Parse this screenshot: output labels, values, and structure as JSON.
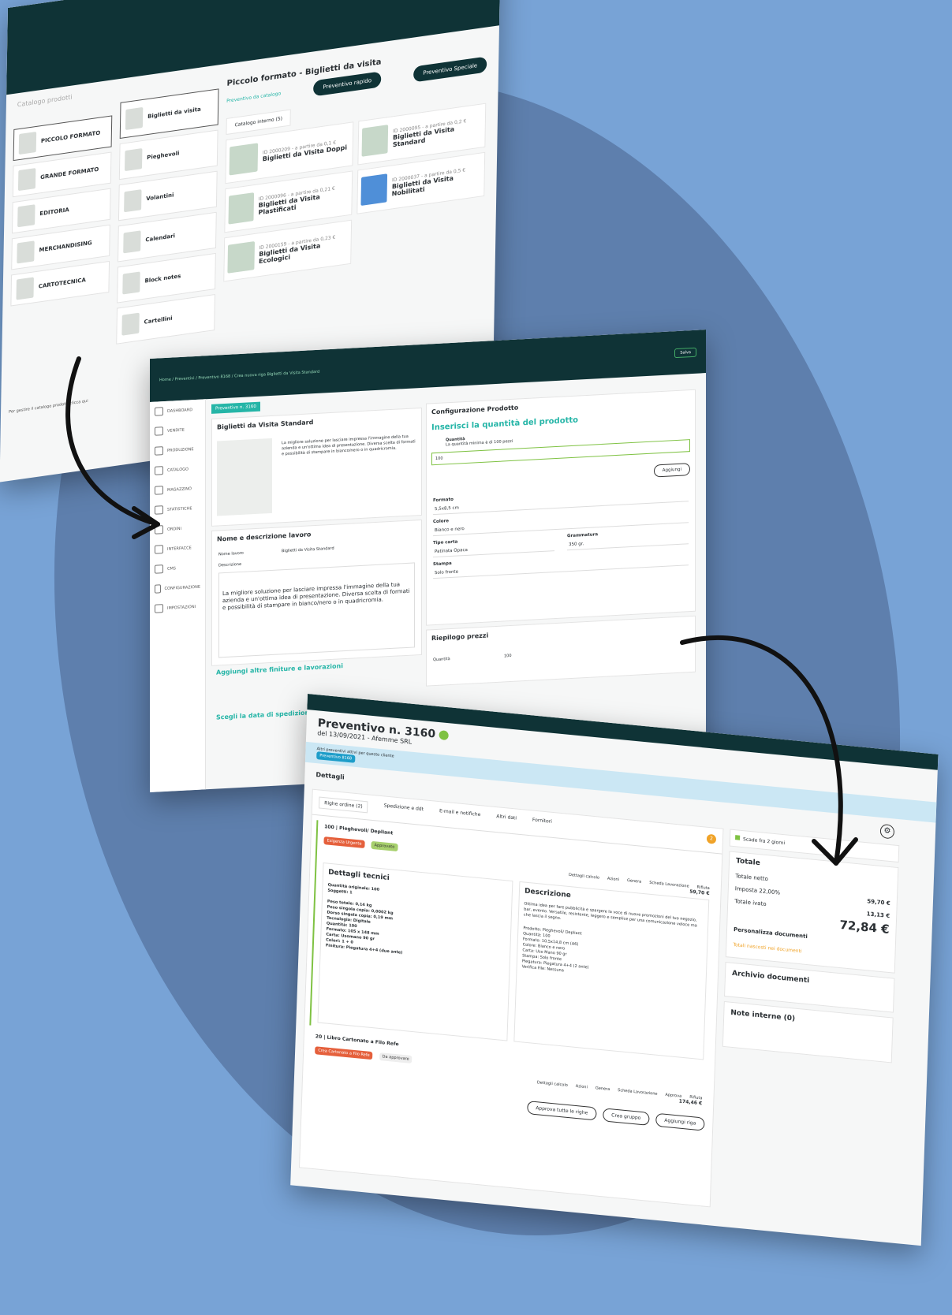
{
  "catalog": {
    "breadcrumb": "Catalogo prodotti",
    "categories": [
      "PICCOLO FORMATO",
      "GRANDE FORMATO",
      "EDITORIA",
      "MERCHANDISING",
      "CARTOTECNICA"
    ],
    "subcategories": [
      "Biglietti da visita",
      "Pieghevoli",
      "Volantini",
      "Calendari",
      "Block notes",
      "Cartellini"
    ],
    "title": "Piccolo formato - Biglietti da visita",
    "btn_quick": "Preventivo rapido",
    "btn_special": "Preventivo Speciale",
    "tab_catalog": "Preventivo da catalogo",
    "internal_tab": "Catalogo interno (5)",
    "products": [
      {
        "meta": "ID 2000209 - a partire da 0,1 €",
        "name": "Biglietti da Visita Doppi"
      },
      {
        "meta": "ID 2000095 - a partire da 0,2 €",
        "name": "Biglietti da Visita Standard"
      },
      {
        "meta": "ID 2000096 - a partire da 0,21 €",
        "name": "Biglietti da Visita Plastificati"
      },
      {
        "meta": "ID 2000037 - a partire da 0,5 €",
        "name": "Biglietti da Visita Nobilitati"
      },
      {
        "meta": "ID 2000159 - a partire da 0,23 €",
        "name": "Biglietti da Visita Ecologici"
      }
    ],
    "footer": "Per gestire il catalogo prodotti clicca qui"
  },
  "config": {
    "breadcrumb": "Home / Preventivi / Preventivo 8168 / Crea nuova riga Biglietti da Visita Standard",
    "save": "Salva",
    "sidebar": [
      "DASHBOARD",
      "VENDITE",
      "PRODUZIONE",
      "CATALOGO",
      "MAGAZZINO",
      "STATISTICHE",
      "ORDINI",
      "INTERFACCE",
      "CMS",
      "CONFIGURAZIONE",
      "IMPOSTAZIONI"
    ],
    "quote_chip": "Preventivo n. 3160",
    "product_name": "Biglietti da Visita Standard",
    "product_desc": "La migliore soluzione per lasciare impressa l'immagine della tua azienda e un'ottima idea di presentazione. Diversa scelta di formati e possibilità di stampare in bianco/nero o in quadricromia.",
    "job_section": "Nome e descrizione lavoro",
    "job_name_label": "Nome lavoro",
    "job_name_value": "Biglietti da Visita Standard",
    "job_desc_label": "Descrizione",
    "job_desc_text": "La migliore soluzione per lasciare impressa l'immagine della tua azienda e un'ottima idea di presentazione. Diversa scelta di formati e possibilità di stampare in bianco/nero o in quadricromia.",
    "finishing": "Aggiungi altre finiture e lavorazioni",
    "shipping": "Scegli la data di spedizione",
    "config_title": "Configurazione Prodotto",
    "qty_heading": "Inserisci la quantità del prodotto",
    "qty_label": "Quantità",
    "qty_hint": "La quantità minima è di 100 pezzi",
    "qty_value": "100",
    "add_btn": "Aggiungi",
    "format_label": "Formato",
    "format_value": "5,5x8,5 cm",
    "color_label": "Colore",
    "color_value": "Bianco e nero",
    "paper_label": "Tipo carta",
    "paper_value": "Patinata Opaca",
    "weight_label": "Grammatura",
    "weight_value": "350 gr.",
    "print_label": "Stampa",
    "print_value": "Solo fronte",
    "summary_title": "Riepilogo prezzi",
    "summary_qty_label": "Quantità",
    "summary_qty": "100"
  },
  "quote": {
    "title": "Preventivo n. 3160",
    "subtitle": "del 13/09/2021 - Afemme SRL",
    "alert": "Altri preventivi attivi per questo cliente",
    "alert_chip": "Preventivo 8168",
    "details": "Dettagli",
    "tabs": [
      "Righe ordine (2)",
      "Spedizione e ddt",
      "E-mail e notifiche",
      "Altri dati",
      "Fornitori"
    ],
    "line1": {
      "title": "100 | Pieghevoli/ Depliant",
      "tags": [
        "Esigenza Urgente",
        "Approvato"
      ],
      "price": "59,70 €"
    },
    "tech_title": "Dettagli tecnici",
    "tech_lines": [
      "Quantità originale: 100",
      "Soggetti: 1",
      "Peso totale: 0,14 kg",
      "Peso singola copia: 0,0002 kg",
      "Dorso singola copia: 0,19 mm",
      "Tecnologia: Digitale",
      "Quantità: 100",
      "Formato: 105 x 148 mm",
      "Carta: Usomano 90 gr",
      "Colori: 1 + 0",
      "Finitura: Piegatura 4+4 (due ante)"
    ],
    "desc_title": "Descrizione",
    "desc_text": "Ottima idea per fare pubblicità e spargere la voce di nuove promozioni del tuo negozio, bar, evento. Versatile, resistente, leggero e semplice per una comunicazione veloce ma che lascia il segno.",
    "desc_specs": [
      "Prodotto: Pieghevoli/ Depliant",
      "Quantità: 100",
      "Formato: 10,5x14,8 cm (A6)",
      "Colore: Bianco e nero",
      "Carta: Uso Mano 90 gr",
      "Stampa: Solo fronte",
      "Piegatura: Piegatura 4+4 (2 ante)",
      "Verifica File: Nessuna"
    ],
    "line_actions": [
      "Dettagli calcolo",
      "Azioni",
      "Genera",
      "Scheda Lavorazione",
      "Rifiuta"
    ],
    "line2": {
      "title": "20 | Libro Cartonato a Filo Refe",
      "tags": [
        "Crea Cartonato a Filo Refe",
        "Da approvare"
      ],
      "price": "174,46 €"
    },
    "line2_actions": [
      "Dettagli calcolo",
      "Azioni",
      "Genera",
      "Scheda Lavorazione",
      "Approva",
      "Rifiuta"
    ],
    "bottom_btns": [
      "Approva tutte le righe",
      "Crea gruppo",
      "Aggiungi riga"
    ],
    "expiry": "Scade fra 2 giorni",
    "total_title": "Totale",
    "net_label": "Totale netto",
    "net_value": "59,70 €",
    "vat_label": "Imposta 22,00%",
    "vat_value": "13,13 €",
    "gross_label": "Totale ivato",
    "gross_value": "72,84 €",
    "customize": "Personalizza documenti",
    "totals_hidden": "Totali nascosti nei documenti",
    "archive": "Archivio documenti",
    "notes": "Note interne (0)",
    "badge_count": "2"
  },
  "colors": {
    "dark": "#0f3336",
    "teal": "#25b5a7",
    "green": "#7fc243",
    "red": "#e5603c",
    "bg": "#78a3d6"
  }
}
